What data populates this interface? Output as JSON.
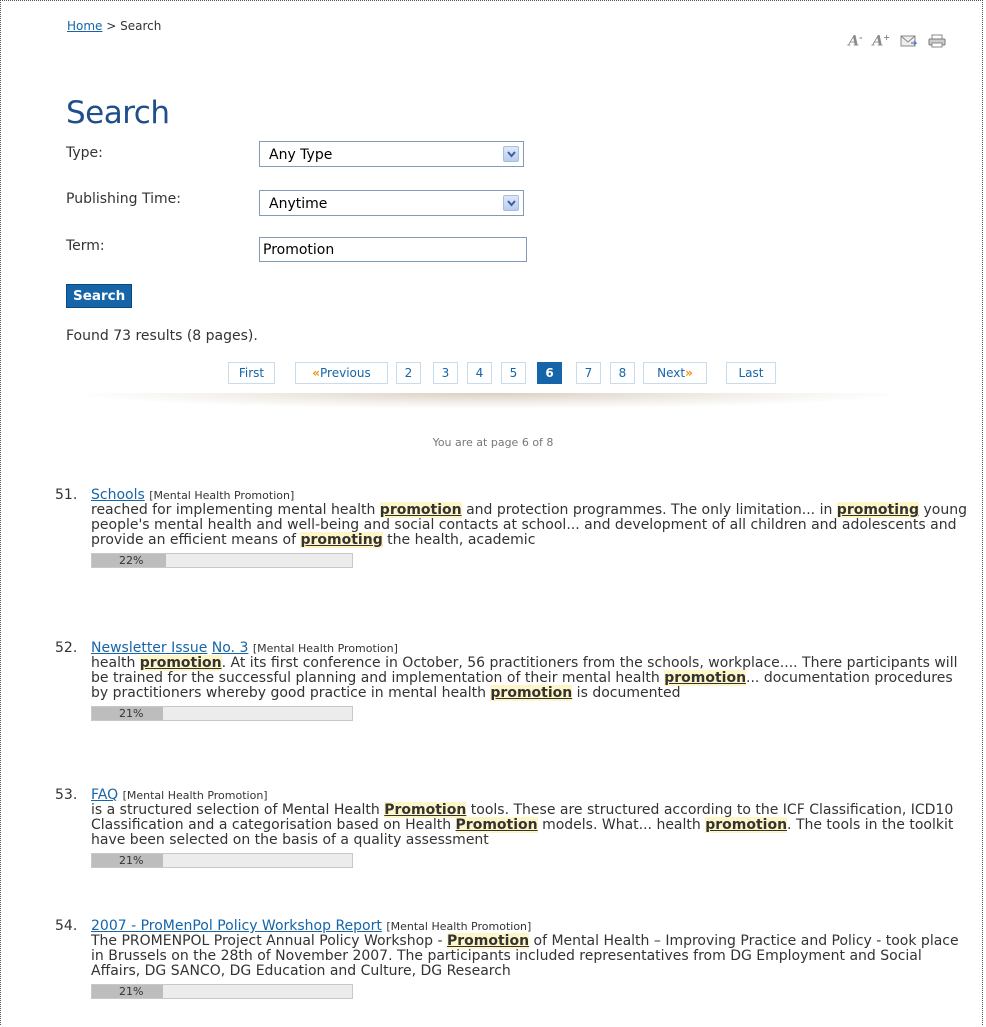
{
  "breadcrumb": {
    "home": "Home",
    "separator": " > ",
    "current": "Search"
  },
  "tools": {
    "font_decrease": "A",
    "font_increase": "A",
    "email_icon": "envelope-icon",
    "print_icon": "printer-icon"
  },
  "title": "Search",
  "form": {
    "type_label": "Type:",
    "type_value": "Any Type",
    "time_label": "Publishing Time:",
    "time_value": "Anytime",
    "term_label": "Term:",
    "term_value": "Promotion",
    "search_button": "Search"
  },
  "found_text": "Found 73 results (8 pages).",
  "pager": {
    "first": "First",
    "previous": "Previous",
    "pages": [
      "2",
      "3",
      "4",
      "5",
      "6",
      "7",
      "8"
    ],
    "current": "6",
    "next": "Next",
    "last": "Last"
  },
  "page_note": "You are at page 6 of 8",
  "results": [
    {
      "num": "51.",
      "title": "Schools",
      "category": "[Mental Health Promotion]",
      "snippet_html": "reached for implementing mental health <span class=\"hl\">promotion</span> and protection programmes. The only limitation... in <span class=\"hl\">promoting</span> young people's mental health and well-being and social contacts at school... and development of all children and adolescents and provide an efficient means of <span class=\"hl\">promoting</span> the health, academic",
      "score": "22%",
      "score_value": 0.22
    },
    {
      "num": "52.",
      "title": "Newsletter Issue",
      "title2": "No. 3",
      "category": "[Mental Health Promotion]",
      "snippet_html": "health <span class=\"hl\">promotion</span>. At its first conference in October, 56 practitioners from the schools, workplace.... There participants will be trained for the successful planning and implementation of their mental health <span class=\"hl\">promotion</span>... documentation procedures by practitioners whereby good practice in mental health <span class=\"hl\">promotion</span> is documented",
      "score": "21%",
      "score_value": 0.21
    },
    {
      "num": "53.",
      "title": "FAQ",
      "category": "[Mental Health Promotion]",
      "snippet_html": "is a structured selection of Mental Health <span class=\"hl\">Promotion</span> tools. These are structured according to the ICF Classification, ICD10 Classification and a categorisation based on Health <span class=\"hl\">Promotion</span> models. What... health <span class=\"hl\">promotion</span>. The tools in the toolkit have been selected on the basis of a quality assessment",
      "score": "21%",
      "score_value": 0.21
    },
    {
      "num": "54.",
      "title": "2007 - ProMenPol Policy Workshop Report",
      "category": "[Mental Health Promotion]",
      "snippet_html": "The PROMENPOL Project Annual Policy Workshop - <span class=\"hl\">Promotion</span> of Mental Health – Improving Practice and Policy - took place in Brussels on the 28th of November 2007. The participants included representatives from DG Employment and Social Affairs, DG SANCO, DG Education and Culture, DG Research",
      "score": "21%",
      "score_value": 0.21
    }
  ]
}
